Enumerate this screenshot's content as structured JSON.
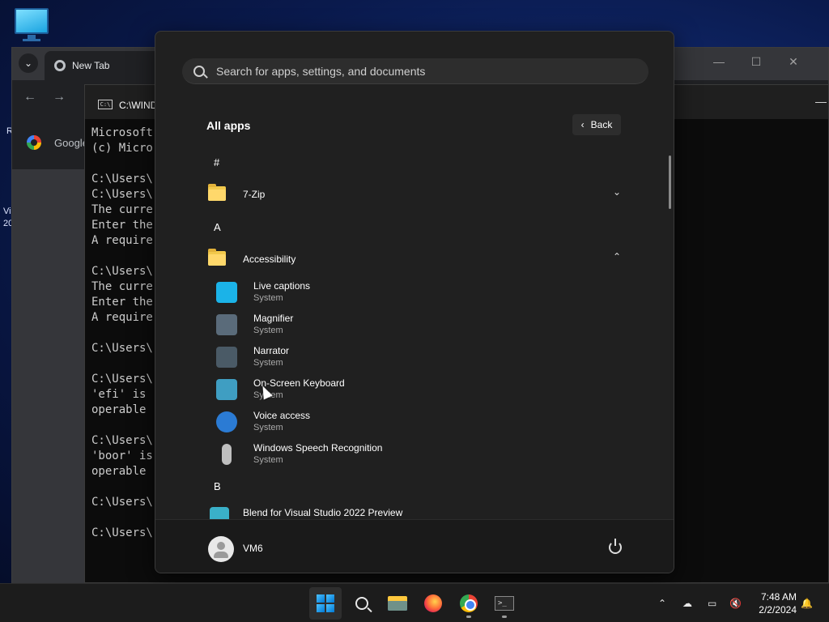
{
  "desktop": {
    "left_fragment_1": "R",
    "left_fragment_2": "Vi",
    "left_fragment_3": "20"
  },
  "chrome": {
    "tab_title": "New Tab",
    "bookmark_label": "Google"
  },
  "cmd": {
    "title": "C:\\WIND",
    "lines": [
      "Microsoft",
      "(c) Micro",
      "",
      "C:\\Users\\",
      "C:\\Users\\",
      "The curre",
      "Enter the",
      "A require",
      "",
      "C:\\Users\\",
      "The curre",
      "Enter the",
      "A require",
      "",
      "C:\\Users\\",
      "",
      "C:\\Users\\",
      "'efi' is",
      "operable",
      "",
      "C:\\Users\\",
      "'boor' is",
      "operable",
      "",
      "C:\\Users\\",
      "",
      "C:\\Users\\"
    ]
  },
  "start_menu": {
    "search_placeholder": "Search for apps, settings, and documents",
    "heading": "All apps",
    "back_label": "Back",
    "groups": {
      "hash": "#",
      "a": "A",
      "b": "B"
    },
    "folders": {
      "zip": "7-Zip",
      "accessibility": "Accessibility"
    },
    "apps": [
      {
        "name": "Live captions",
        "sub": "System",
        "icon": "live-captions-icon"
      },
      {
        "name": "Magnifier",
        "sub": "System",
        "icon": "magnifier-icon"
      },
      {
        "name": "Narrator",
        "sub": "System",
        "icon": "narrator-icon"
      },
      {
        "name": "On-Screen Keyboard",
        "sub": "System",
        "icon": "keyboard-icon"
      },
      {
        "name": "Voice access",
        "sub": "System",
        "icon": "voice-access-icon"
      },
      {
        "name": "Windows Speech Recognition",
        "sub": "System",
        "icon": "microphone-icon"
      }
    ],
    "blend_app": "Blend for Visual Studio 2022 Preview",
    "user_name": "VM6"
  },
  "taskbar": {
    "time": "7:48 AM",
    "date": "2/2/2024",
    "terminal_glyph": ">_"
  },
  "colors": {
    "accent": "#0078d4",
    "menu_bg": "#202020"
  }
}
